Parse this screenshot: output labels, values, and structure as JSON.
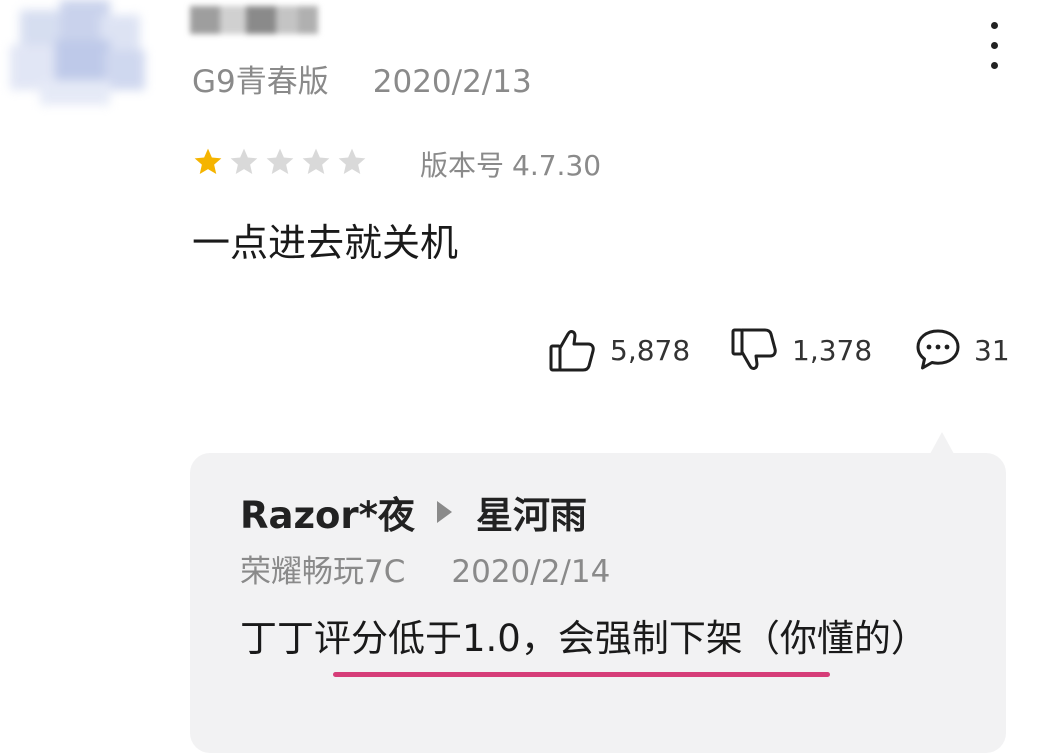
{
  "review": {
    "device": "G9青春版",
    "date": "2020/2/13",
    "rating": 1,
    "max_rating": 5,
    "version_label": "版本号",
    "version_value": "4.7.30",
    "text": "一点进去就关机",
    "likes": "5,878",
    "dislikes": "1,378",
    "comments": "31"
  },
  "reply": {
    "author": "Razor*夜",
    "recipient": "星河雨",
    "device": "荣耀畅玩7C",
    "date": "2020/2/14",
    "text": "丁丁评分低于1.0，会强制下架（你懂的）"
  },
  "colors": {
    "star_filled": "#f5b400",
    "star_empty": "#d9d9d9",
    "underline": "#d63d78",
    "card_bg": "#f2f2f3",
    "meta_text": "#8a8a8a"
  },
  "icons": {
    "more": "more-vertical-icon",
    "like": "thumbs-up-icon",
    "dislike": "thumbs-down-icon",
    "comment": "comment-bubble-icon",
    "arrow": "reply-arrow-icon"
  }
}
